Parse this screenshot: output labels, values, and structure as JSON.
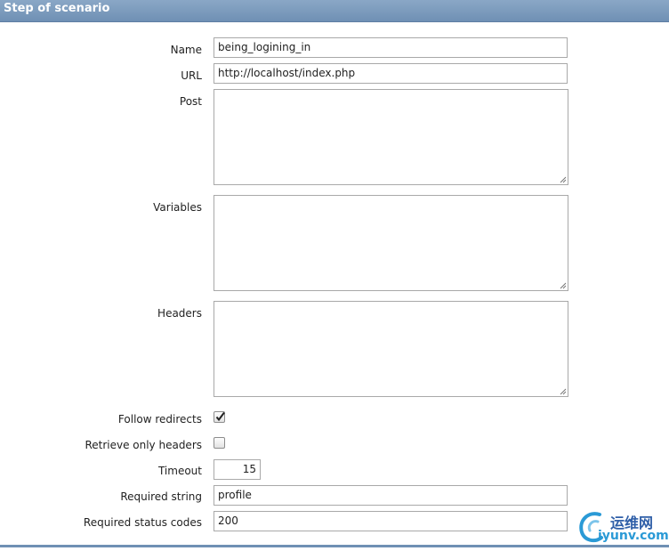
{
  "header": {
    "title": "Step of scenario"
  },
  "form": {
    "name": {
      "label": "Name",
      "value": "being_logining_in"
    },
    "url": {
      "label": "URL",
      "value": "http://localhost/index.php"
    },
    "post": {
      "label": "Post",
      "value": ""
    },
    "variables": {
      "label": "Variables",
      "value": ""
    },
    "headers": {
      "label": "Headers",
      "value": ""
    },
    "follow_redirects": {
      "label": "Follow redirects",
      "checked": true
    },
    "retrieve_only_headers": {
      "label": "Retrieve only headers",
      "checked": false
    },
    "timeout": {
      "label": "Timeout",
      "value": "15"
    },
    "required_string": {
      "label": "Required string",
      "value": "profile"
    },
    "required_status_codes": {
      "label": "Required status codes",
      "value": "200"
    }
  },
  "watermark": {
    "cn": "运维网",
    "en": "iyunv.com"
  },
  "colors": {
    "header_bar": "#7393b7",
    "accent_line": "#6f90b4"
  }
}
